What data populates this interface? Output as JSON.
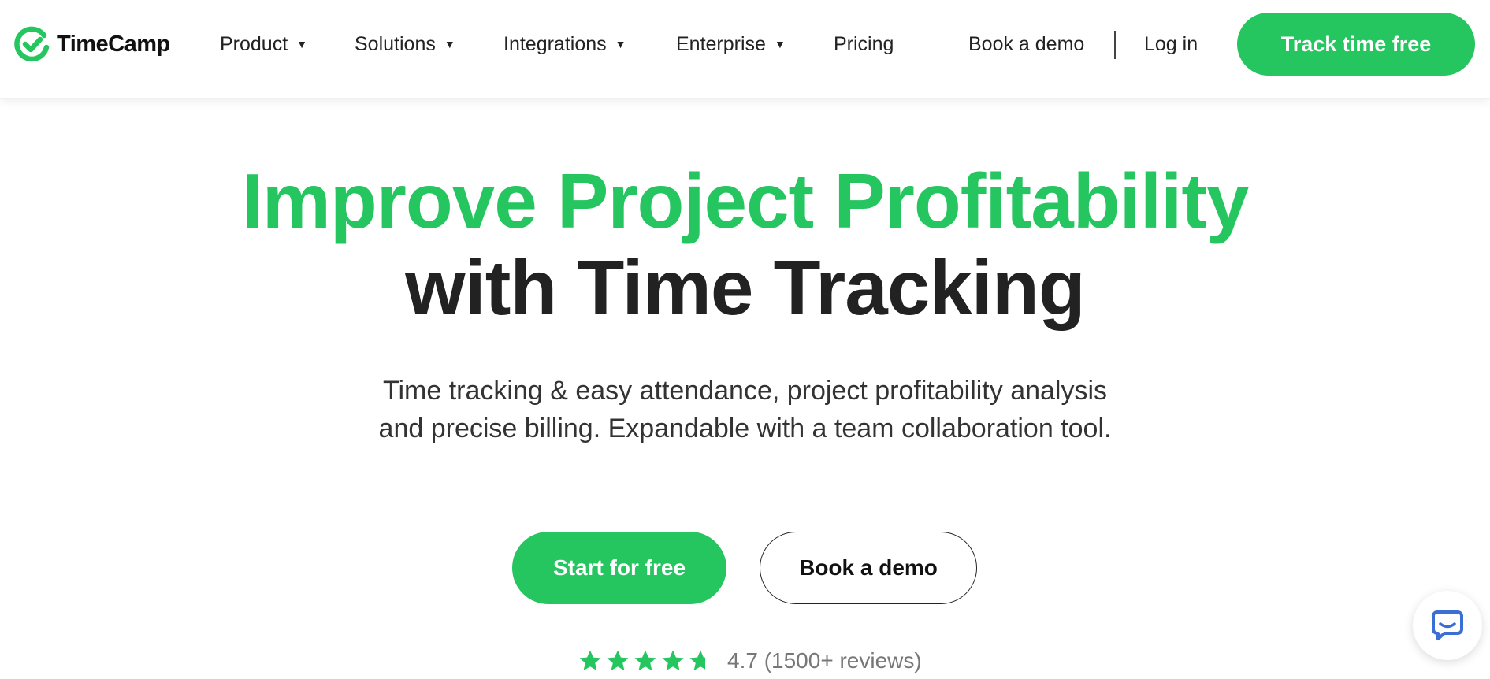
{
  "brand": {
    "name": "TimeCamp",
    "accent_color": "#25c55f",
    "logo_icon": "checkmark-circle-icon"
  },
  "nav": {
    "items": [
      {
        "label": "Product",
        "has_dropdown": true
      },
      {
        "label": "Solutions",
        "has_dropdown": true
      },
      {
        "label": "Integrations",
        "has_dropdown": true
      },
      {
        "label": "Enterprise",
        "has_dropdown": true
      },
      {
        "label": "Pricing",
        "has_dropdown": false
      }
    ],
    "book_demo": "Book a demo",
    "login": "Log in",
    "cta": "Track time free",
    "caret_glyph": "▼"
  },
  "hero": {
    "title_line1": "Improve Project Profitability",
    "title_line2": "with Time Tracking",
    "subtitle_line1": "Time tracking & easy attendance, project profitability analysis",
    "subtitle_line2": "and precise billing. Expandable with a team collaboration tool.",
    "primary_button": "Start for free",
    "secondary_button": "Book a demo"
  },
  "rating": {
    "stars": 4.7,
    "max_stars": 5,
    "text": "4.7 (1500+ reviews)"
  },
  "chat_widget": {
    "icon": "chat-bubble-icon",
    "icon_color": "#3b6fd4"
  }
}
